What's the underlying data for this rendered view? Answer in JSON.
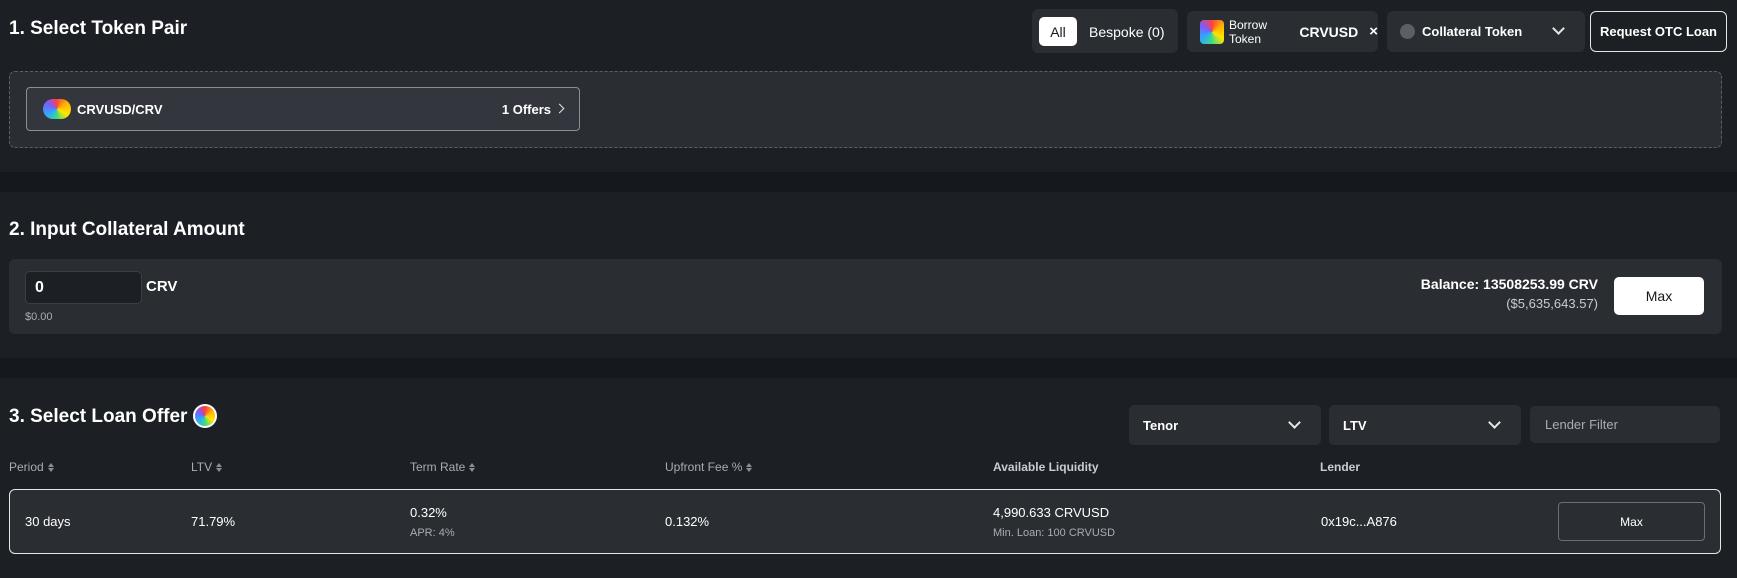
{
  "token_pair": {
    "title": "1. Select Token Pair",
    "filter_all": "All",
    "filter_bespoke": "Bespoke (0)",
    "borrow_label": "Borrow Token",
    "borrow_symbol": "CRVUSD",
    "borrow_clear": "×",
    "collateral_placeholder": "Collateral Token",
    "request_otc_label": "Request OTC Loan",
    "pairs": [
      {
        "name": "CRVUSD/CRV",
        "offers": "1 Offers"
      }
    ]
  },
  "collateral": {
    "title": "2. Input Collateral Amount",
    "amount_value": "0",
    "unit": "CRV",
    "usd_value": "$0.00",
    "balance": "Balance: 13508253.99 CRV",
    "balance_usd": "($5,635,643.57)",
    "max_label": "Max"
  },
  "loan_offer": {
    "title": "3. Select Loan Offer",
    "tenor_label": "Tenor",
    "ltv_label": "LTV",
    "lender_filter_placeholder": "Lender Filter",
    "columns": {
      "period": "Period",
      "ltv": "LTV",
      "term_rate": "Term Rate",
      "upfront_fee": "Upfront Fee %",
      "available_liquidity": "Available Liquidity",
      "lender": "Lender"
    },
    "rows": [
      {
        "period": "30 days",
        "ltv": "71.79%",
        "term_rate": "0.32%",
        "apr": "APR: 4%",
        "upfront_fee": "0.132%",
        "liquidity": "4,990.633 CRVUSD",
        "min_loan": "Min. Loan: 100 CRVUSD",
        "lender": "0x19c...A876",
        "action_label": "Max"
      }
    ]
  },
  "colors": {
    "page_bg": "#15181c",
    "panel_bg": "#1c1f23",
    "card_bg": "#2a2e33",
    "text_primary": "#ffffff",
    "text_muted": "#a8adb4"
  },
  "icons": {
    "token_logo": "crvusd-rainbow-icon",
    "collateral_placeholder": "token-placeholder-icon",
    "dropdown": "chevron-down-icon",
    "next": "chevron-right-icon",
    "sort": "sort-icon"
  }
}
